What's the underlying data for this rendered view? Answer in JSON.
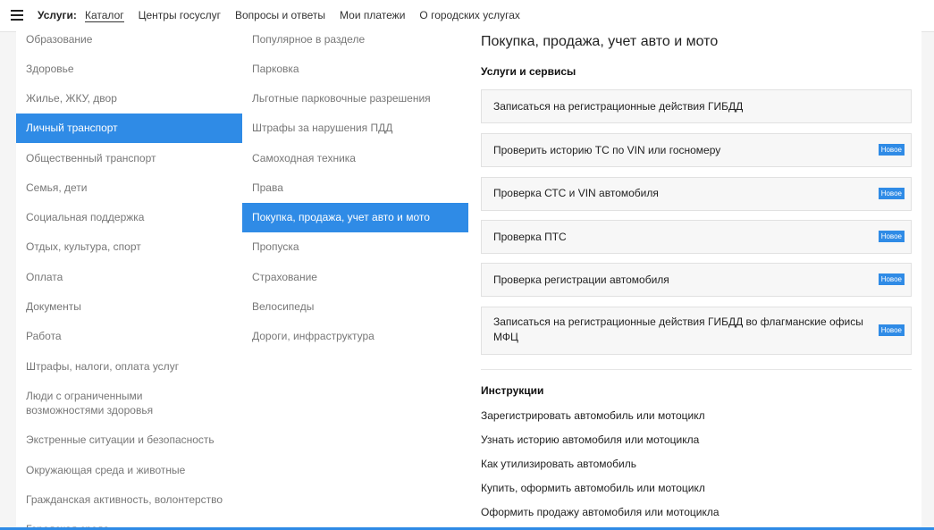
{
  "topbar": {
    "label": "Услуги:",
    "items": [
      "Каталог",
      "Центры госуслуг",
      "Вопросы и ответы",
      "Мои платежи",
      "О городских услугах"
    ]
  },
  "categories": [
    "Образование",
    "Здоровье",
    "Жилье, ЖКУ, двор",
    "Личный транспорт",
    "Общественный транспорт",
    "Семья, дети",
    "Социальная поддержка",
    "Отдых, культура, спорт",
    "Оплата",
    "Документы",
    "Работа",
    "Штрафы, налоги, оплата услуг",
    "Люди с ограниченными возможностями здоровья",
    "Экстренные ситуации и безопасность",
    "Окружающая среда и животные",
    "Гражданская активность, волонтерство",
    "Городская среда"
  ],
  "subcategories": [
    "Популярное в разделе",
    "Парковка",
    "Льготные парковочные разрешения",
    "Штрафы за нарушения ПДД",
    "Самоходная техника",
    "Права",
    "Покупка, продажа, учет авто и мото",
    "Пропуска",
    "Страхование",
    "Велосипеды",
    "Дороги, инфраструктура"
  ],
  "content": {
    "title": "Покупка, продажа, учет авто и мото",
    "services_heading": "Услуги и сервисы",
    "badge_new": "Новое",
    "services": [
      "Записаться на регистрационные действия ГИБДД",
      "Проверить историю ТС по VIN или госномеру",
      "Проверка СТС и VIN автомобиля",
      "Проверка ПТС",
      "Проверка регистрации автомобиля",
      "Записаться на регистрационные действия ГИБДД во флагманские офисы МФЦ"
    ],
    "instructions_heading": "Инструкции",
    "instructions": [
      "Зарегистрировать автомобиль или мотоцикл",
      "Узнать историю автомобиля или мотоцикла",
      "Как утилизировать автомобиль",
      "Купить, оформить автомобиль или мотоцикл",
      "Оформить продажу автомобиля или мотоцикла"
    ]
  },
  "colors": {
    "accent": "#2f8be6"
  }
}
